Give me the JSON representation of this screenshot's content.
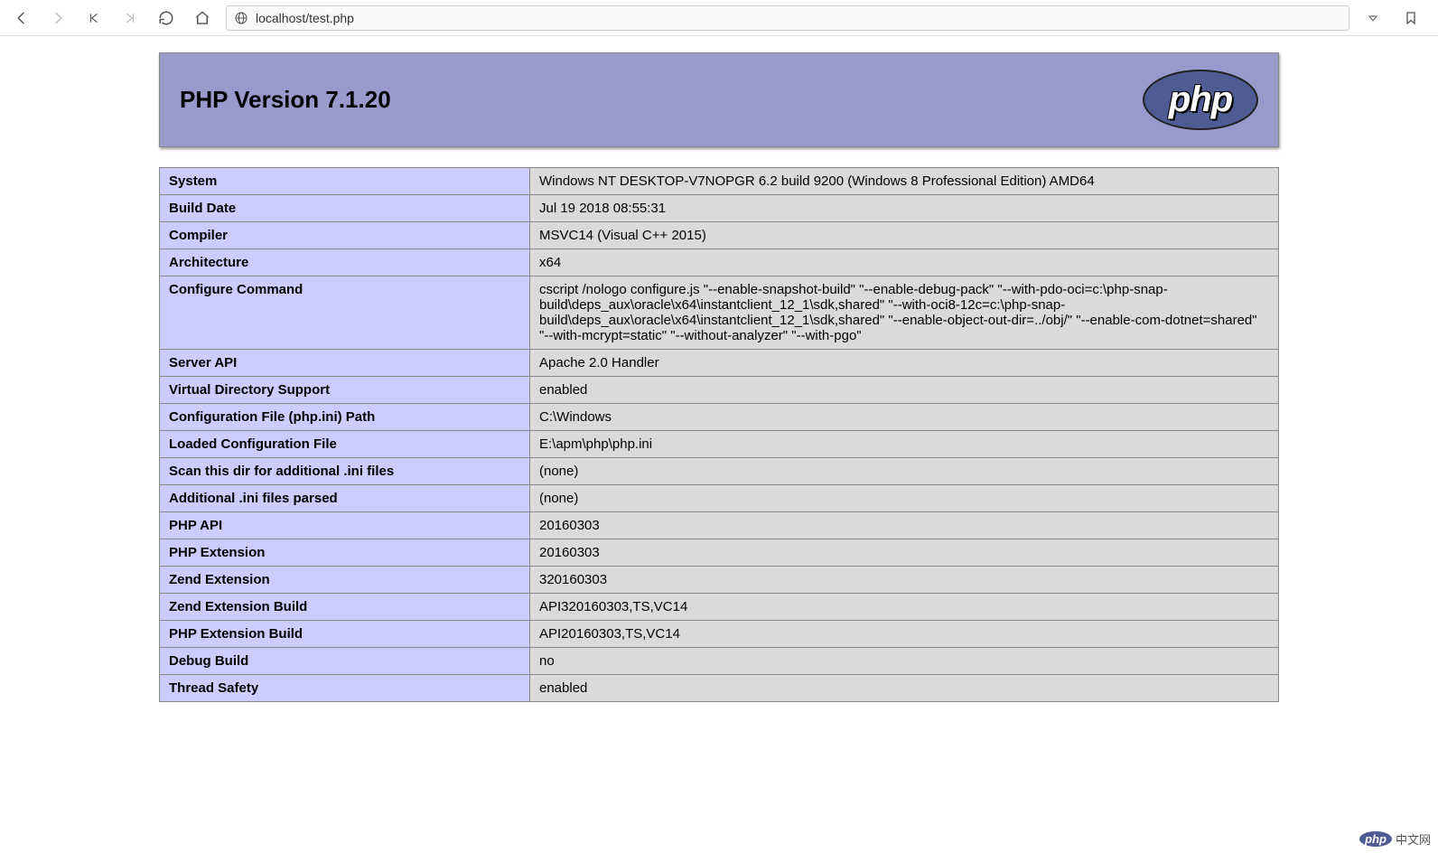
{
  "browser": {
    "url": "localhost/test.php"
  },
  "header": {
    "title": "PHP Version 7.1.20",
    "logo_text": "php"
  },
  "rows": [
    {
      "label": "System",
      "value": "Windows NT DESKTOP-V7NOPGR 6.2 build 9200 (Windows 8 Professional Edition) AMD64"
    },
    {
      "label": "Build Date",
      "value": "Jul 19 2018 08:55:31"
    },
    {
      "label": "Compiler",
      "value": "MSVC14 (Visual C++ 2015)"
    },
    {
      "label": "Architecture",
      "value": "x64"
    },
    {
      "label": "Configure Command",
      "value": "cscript /nologo configure.js \"--enable-snapshot-build\" \"--enable-debug-pack\" \"--with-pdo-oci=c:\\php-snap-build\\deps_aux\\oracle\\x64\\instantclient_12_1\\sdk,shared\" \"--with-oci8-12c=c:\\php-snap-build\\deps_aux\\oracle\\x64\\instantclient_12_1\\sdk,shared\" \"--enable-object-out-dir=../obj/\" \"--enable-com-dotnet=shared\" \"--with-mcrypt=static\" \"--without-analyzer\" \"--with-pgo\""
    },
    {
      "label": "Server API",
      "value": "Apache 2.0 Handler"
    },
    {
      "label": "Virtual Directory Support",
      "value": "enabled"
    },
    {
      "label": "Configuration File (php.ini) Path",
      "value": "C:\\Windows"
    },
    {
      "label": "Loaded Configuration File",
      "value": "E:\\apm\\php\\php.ini"
    },
    {
      "label": "Scan this dir for additional .ini files",
      "value": "(none)"
    },
    {
      "label": "Additional .ini files parsed",
      "value": "(none)"
    },
    {
      "label": "PHP API",
      "value": "20160303"
    },
    {
      "label": "PHP Extension",
      "value": "20160303"
    },
    {
      "label": "Zend Extension",
      "value": "320160303"
    },
    {
      "label": "Zend Extension Build",
      "value": "API320160303,TS,VC14"
    },
    {
      "label": "PHP Extension Build",
      "value": "API20160303,TS,VC14"
    },
    {
      "label": "Debug Build",
      "value": "no"
    },
    {
      "label": "Thread Safety",
      "value": "enabled"
    }
  ],
  "watermark": {
    "pill": "php",
    "text": "中文网"
  }
}
